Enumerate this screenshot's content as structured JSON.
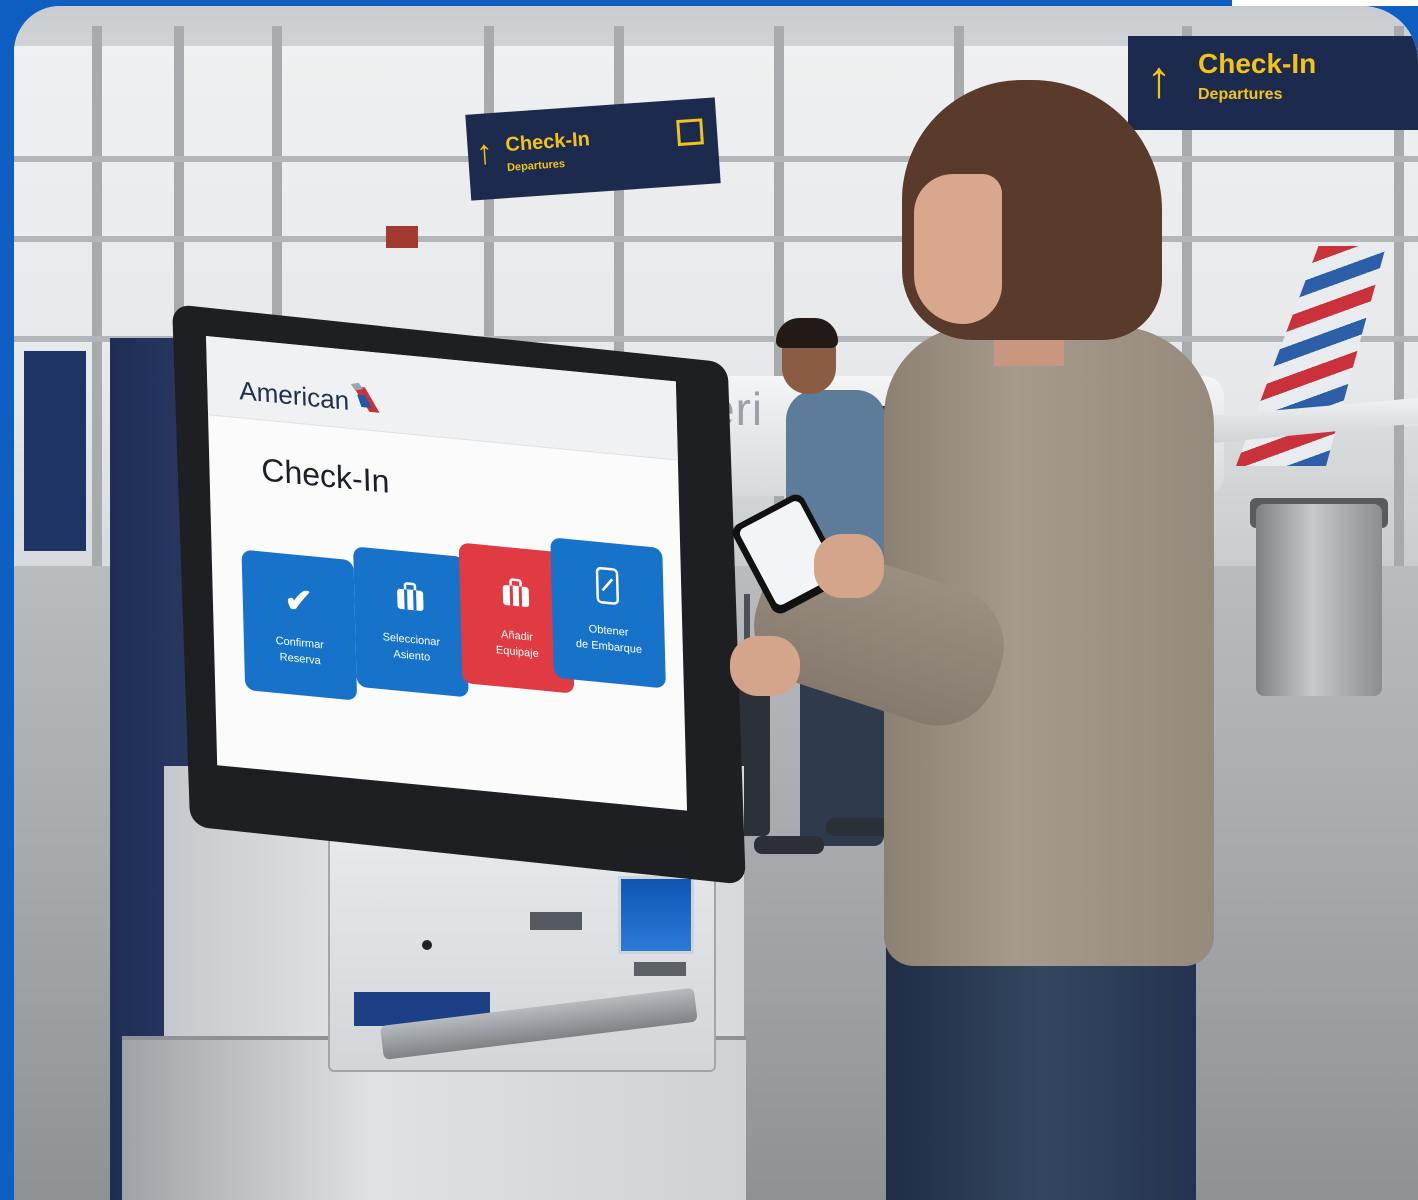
{
  "scene": {
    "colors": {
      "frame_blue": "#0f5fc2",
      "sign_navy": "#1c2a4d",
      "sign_yellow": "#f3c316",
      "tile_blue": "#1773c9",
      "tile_red": "#e03a42",
      "brand_text": "#1f2f4d"
    }
  },
  "signs": {
    "right": {
      "title": "Check-In",
      "subtitle": "Departures"
    },
    "center": {
      "title": "Check-In",
      "subtitle": "Departures"
    }
  },
  "aircraft": {
    "livery_text": "Ameri"
  },
  "kiosk": {
    "brand": "American",
    "brand_icon": "american-airlines-flight-symbol-icon",
    "screen_title": "Check-In",
    "tiles": [
      {
        "icon": "check-icon",
        "glyph": "✔",
        "label_line1": "Confirmar",
        "label_line2": "Reserva",
        "color": "#1773c9"
      },
      {
        "icon": "luggage-icon",
        "glyph": "",
        "label_line1": "Seleccionar",
        "label_line2": "Asiento",
        "color": "#1773c9"
      },
      {
        "icon": "baggage-icon",
        "glyph": "",
        "label_line1": "Añadir",
        "label_line2": "Equipaje",
        "color": "#e03a42"
      },
      {
        "icon": "mobile-boarding-pass-icon",
        "glyph": "",
        "label_line1": "Obtener",
        "label_line2": "de Embarque",
        "color": "#1773c9"
      }
    ]
  }
}
